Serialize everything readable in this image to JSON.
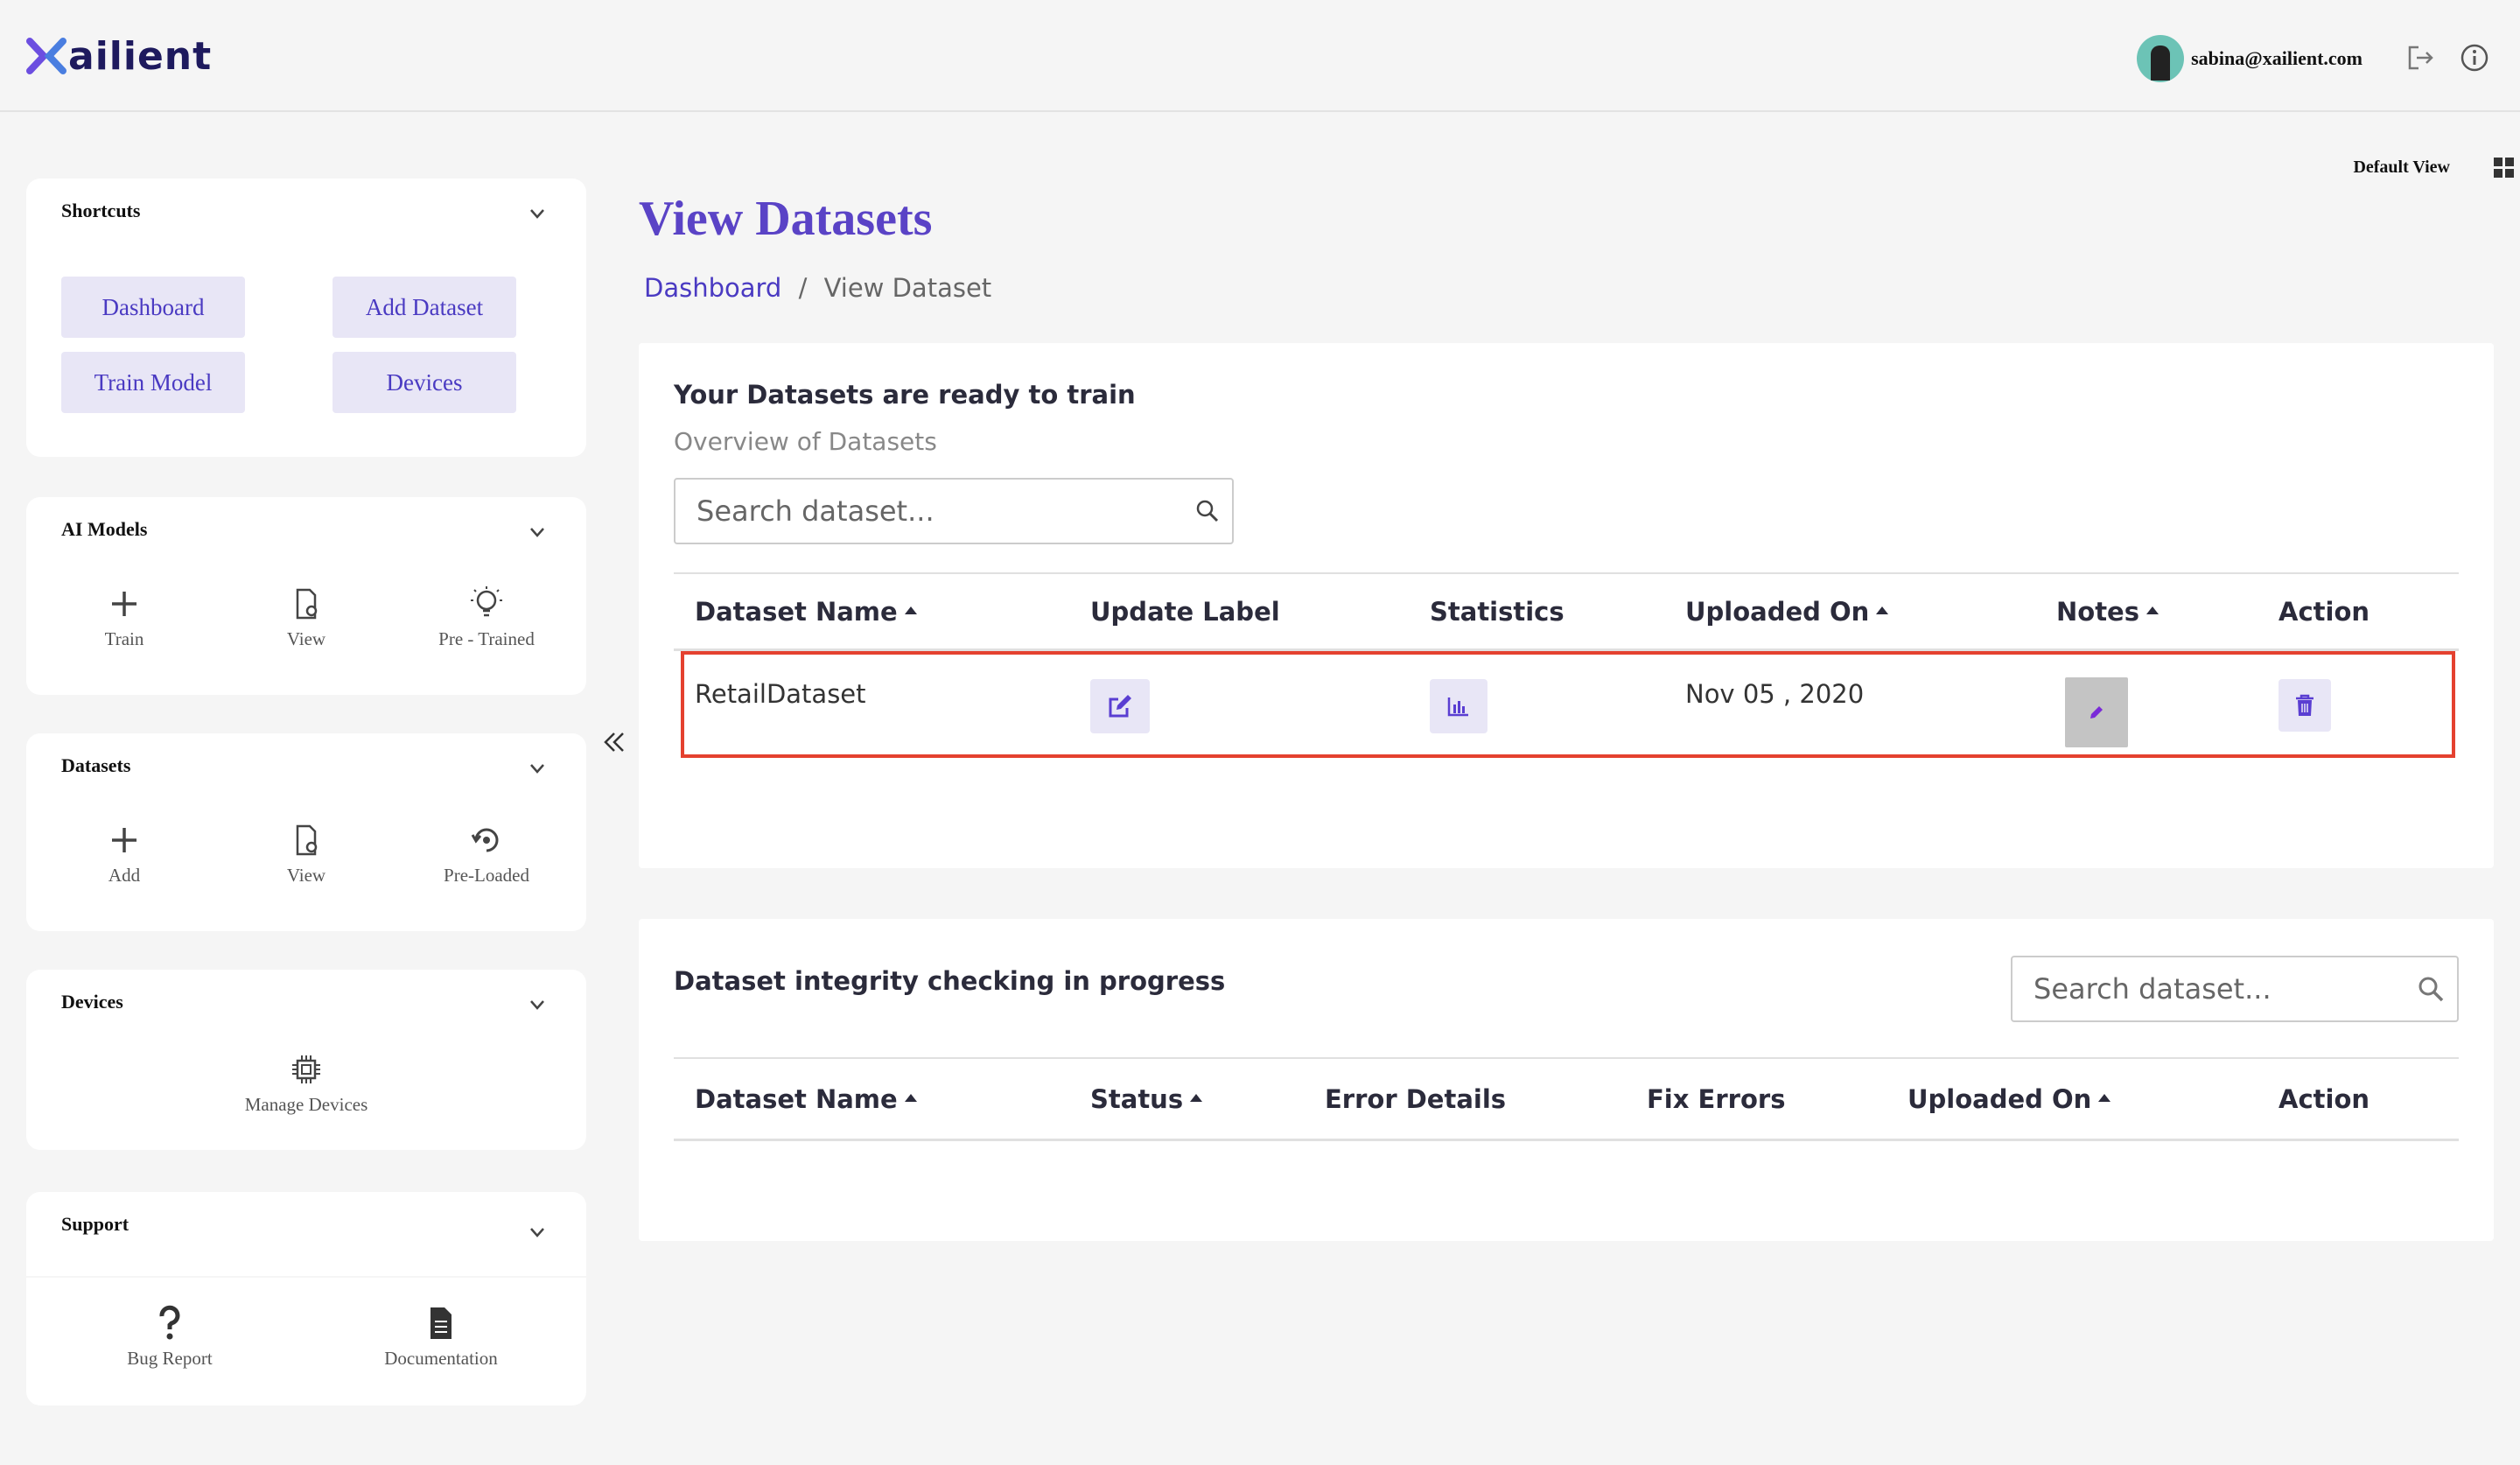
{
  "header": {
    "brand": "ailient",
    "user_email": "sabina@xailient.com",
    "icons": [
      "logout-icon",
      "info-icon"
    ]
  },
  "view_toggle": {
    "label": "Default View",
    "icon": "grid-icon"
  },
  "sidebar": {
    "shortcuts": {
      "title": "Shortcuts",
      "buttons": [
        "Dashboard",
        "Add Dataset",
        "Train Model",
        "Devices"
      ]
    },
    "ai_models": {
      "title": "AI Models",
      "tools": [
        {
          "label": "Train",
          "icon": "plus-icon"
        },
        {
          "label": "View",
          "icon": "file-view-icon"
        },
        {
          "label": "Pre - Trained",
          "icon": "lightbulb-icon"
        }
      ]
    },
    "datasets": {
      "title": "Datasets",
      "tools": [
        {
          "label": "Add",
          "icon": "plus-icon"
        },
        {
          "label": "View",
          "icon": "file-view-icon"
        },
        {
          "label": "Pre-Loaded",
          "icon": "reload-icon"
        }
      ]
    },
    "devices": {
      "title": "Devices",
      "tools": [
        {
          "label": "Manage Devices",
          "icon": "chip-icon"
        }
      ]
    },
    "support": {
      "title": "Support",
      "tools": [
        {
          "label": "Bug Report",
          "icon": "question-icon"
        },
        {
          "label": "Documentation",
          "icon": "document-icon"
        }
      ]
    }
  },
  "main": {
    "title": "View Datasets",
    "breadcrumb": {
      "link": "Dashboard",
      "separator": "/",
      "current": "View Dataset"
    },
    "ready_card": {
      "title": "Your Datasets are ready to train",
      "subtitle": "Overview of Datasets",
      "search_placeholder": "Search dataset...",
      "columns": [
        "Dataset Name",
        "Update Label",
        "Statistics",
        "Uploaded On",
        "Notes",
        "Action"
      ],
      "rows": [
        {
          "name": "RetailDataset",
          "uploaded_on": "Nov 05 , 2020"
        }
      ]
    },
    "integrity_card": {
      "title": "Dataset integrity checking in progress",
      "search_placeholder": "Search dataset...",
      "columns": [
        "Dataset Name",
        "Status",
        "Error Details",
        "Fix Errors",
        "Uploaded On",
        "Action"
      ]
    }
  },
  "colors": {
    "accent": "#5a43c6",
    "button_bg": "#e8e6f6",
    "highlight": "#e4412f"
  }
}
